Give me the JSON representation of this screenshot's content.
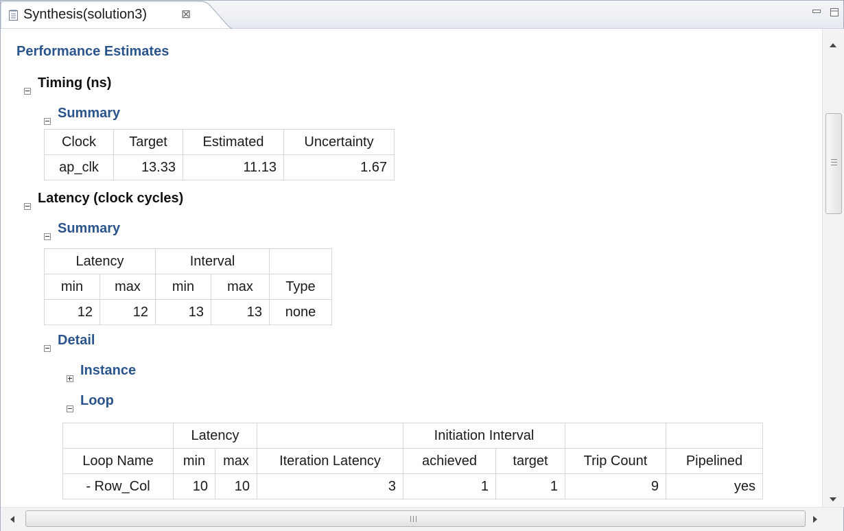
{
  "tab": {
    "title": "Synthesis(solution3)",
    "close_glyph": "⊠"
  },
  "report": {
    "heading": "Performance Estimates",
    "timing": {
      "heading": "Timing (ns)",
      "summary": {
        "heading": "Summary",
        "headers": [
          "Clock",
          "Target",
          "Estimated",
          "Uncertainty"
        ],
        "row": [
          "ap_clk",
          "13.33",
          "11.13",
          "1.67"
        ]
      }
    },
    "latency": {
      "heading": "Latency (clock cycles)",
      "summary": {
        "heading": "Summary",
        "group_headers": [
          "Latency",
          "Interval",
          ""
        ],
        "headers": [
          "min",
          "max",
          "min",
          "max",
          "Type"
        ],
        "row": [
          "12",
          "12",
          "13",
          "13",
          "none"
        ]
      },
      "detail": {
        "heading": "Detail",
        "instance": {
          "heading": "Instance"
        },
        "loop": {
          "heading": "Loop",
          "group_headers": [
            "",
            "Latency",
            "",
            "Initiation Interval",
            "",
            ""
          ],
          "headers": [
            "Loop Name",
            "min",
            "max",
            "Iteration Latency",
            "achieved",
            "target",
            "Trip Count",
            "Pipelined"
          ],
          "row": [
            "- Row_Col",
            "10",
            "10",
            "3",
            "1",
            "1",
            "9",
            "yes"
          ]
        }
      }
    }
  },
  "colors": {
    "heading_blue": "#2a558c",
    "border": "#d6d6d6"
  },
  "icons": [
    "report-file-icon",
    "close-tab-icon",
    "minimize-icon",
    "maximize-icon",
    "collapse-icon",
    "expand-icon",
    "scroll-up-icon",
    "scroll-down-icon",
    "scroll-left-icon",
    "scroll-right-icon"
  ]
}
